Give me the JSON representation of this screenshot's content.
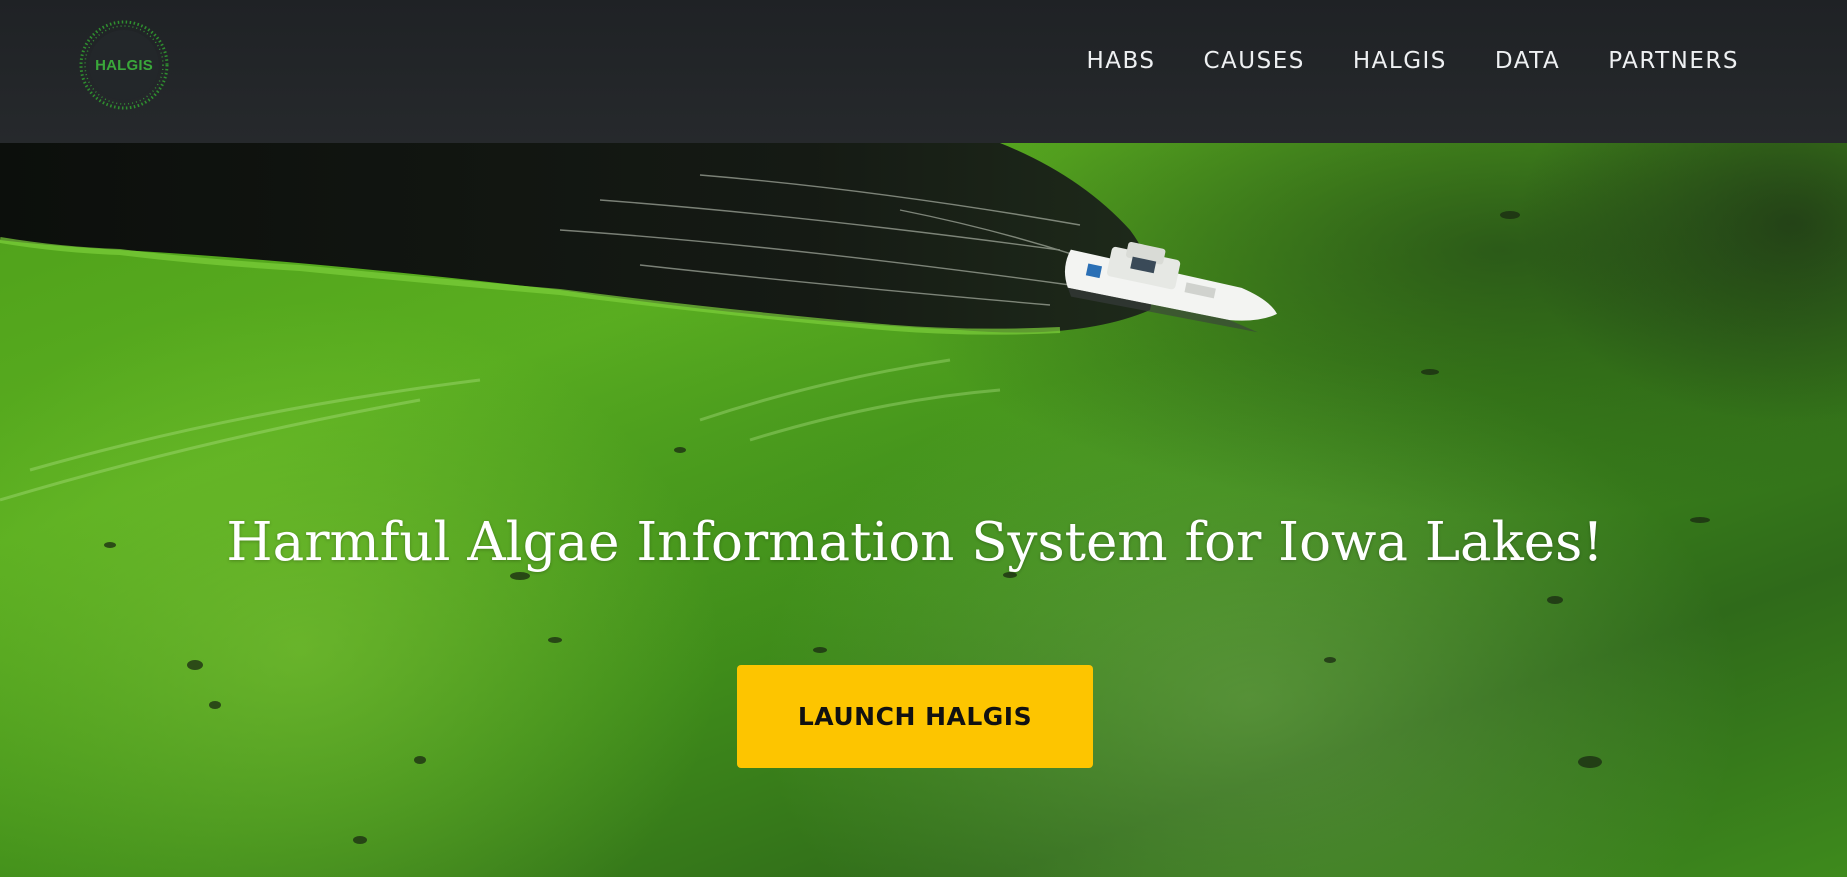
{
  "brand": {
    "logo_text": "HALGIS",
    "logo_icon": "halgis-dotted-circle-logo",
    "logo_color": "#3aa83a"
  },
  "nav": {
    "items": [
      {
        "label": "HABS"
      },
      {
        "label": "CAUSES"
      },
      {
        "label": "HALGIS"
      },
      {
        "label": "DATA"
      },
      {
        "label": "PARTNERS"
      }
    ]
  },
  "hero": {
    "background_image": "aerial-boat-on-green-algae-lake",
    "headline": "Harmful Algae Information System for Iowa Lakes!",
    "cta_label": "LAUNCH HALGIS",
    "cta_color": "#fdc500"
  },
  "colors": {
    "navbar_bg": "#24272a",
    "nav_text": "#eef0f2",
    "algae_green": "#4f9f1c"
  }
}
